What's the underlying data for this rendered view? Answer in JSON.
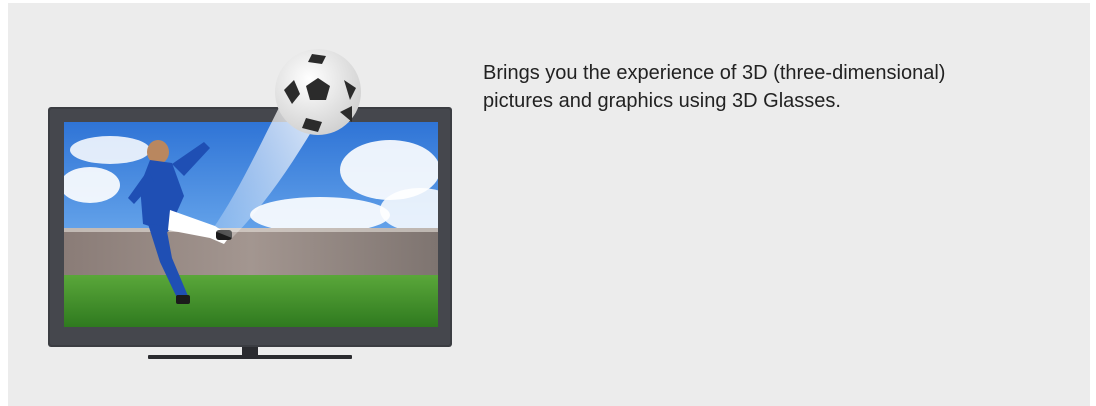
{
  "description": "Brings you the experience of 3D (three-dimensional) pictures and graphics using 3D Glasses.",
  "illustration": {
    "subject": "3D TV showing a soccer player kicking a ball out of the screen",
    "colors": {
      "panel_background": "#ececec",
      "tv_frame": "#3b3d42",
      "tv_stand": "#2a2b2f",
      "sky": "#4a8fe0",
      "grass": "#3f8f2b",
      "jersey": "#1f4fb4",
      "text": "#222222"
    }
  }
}
